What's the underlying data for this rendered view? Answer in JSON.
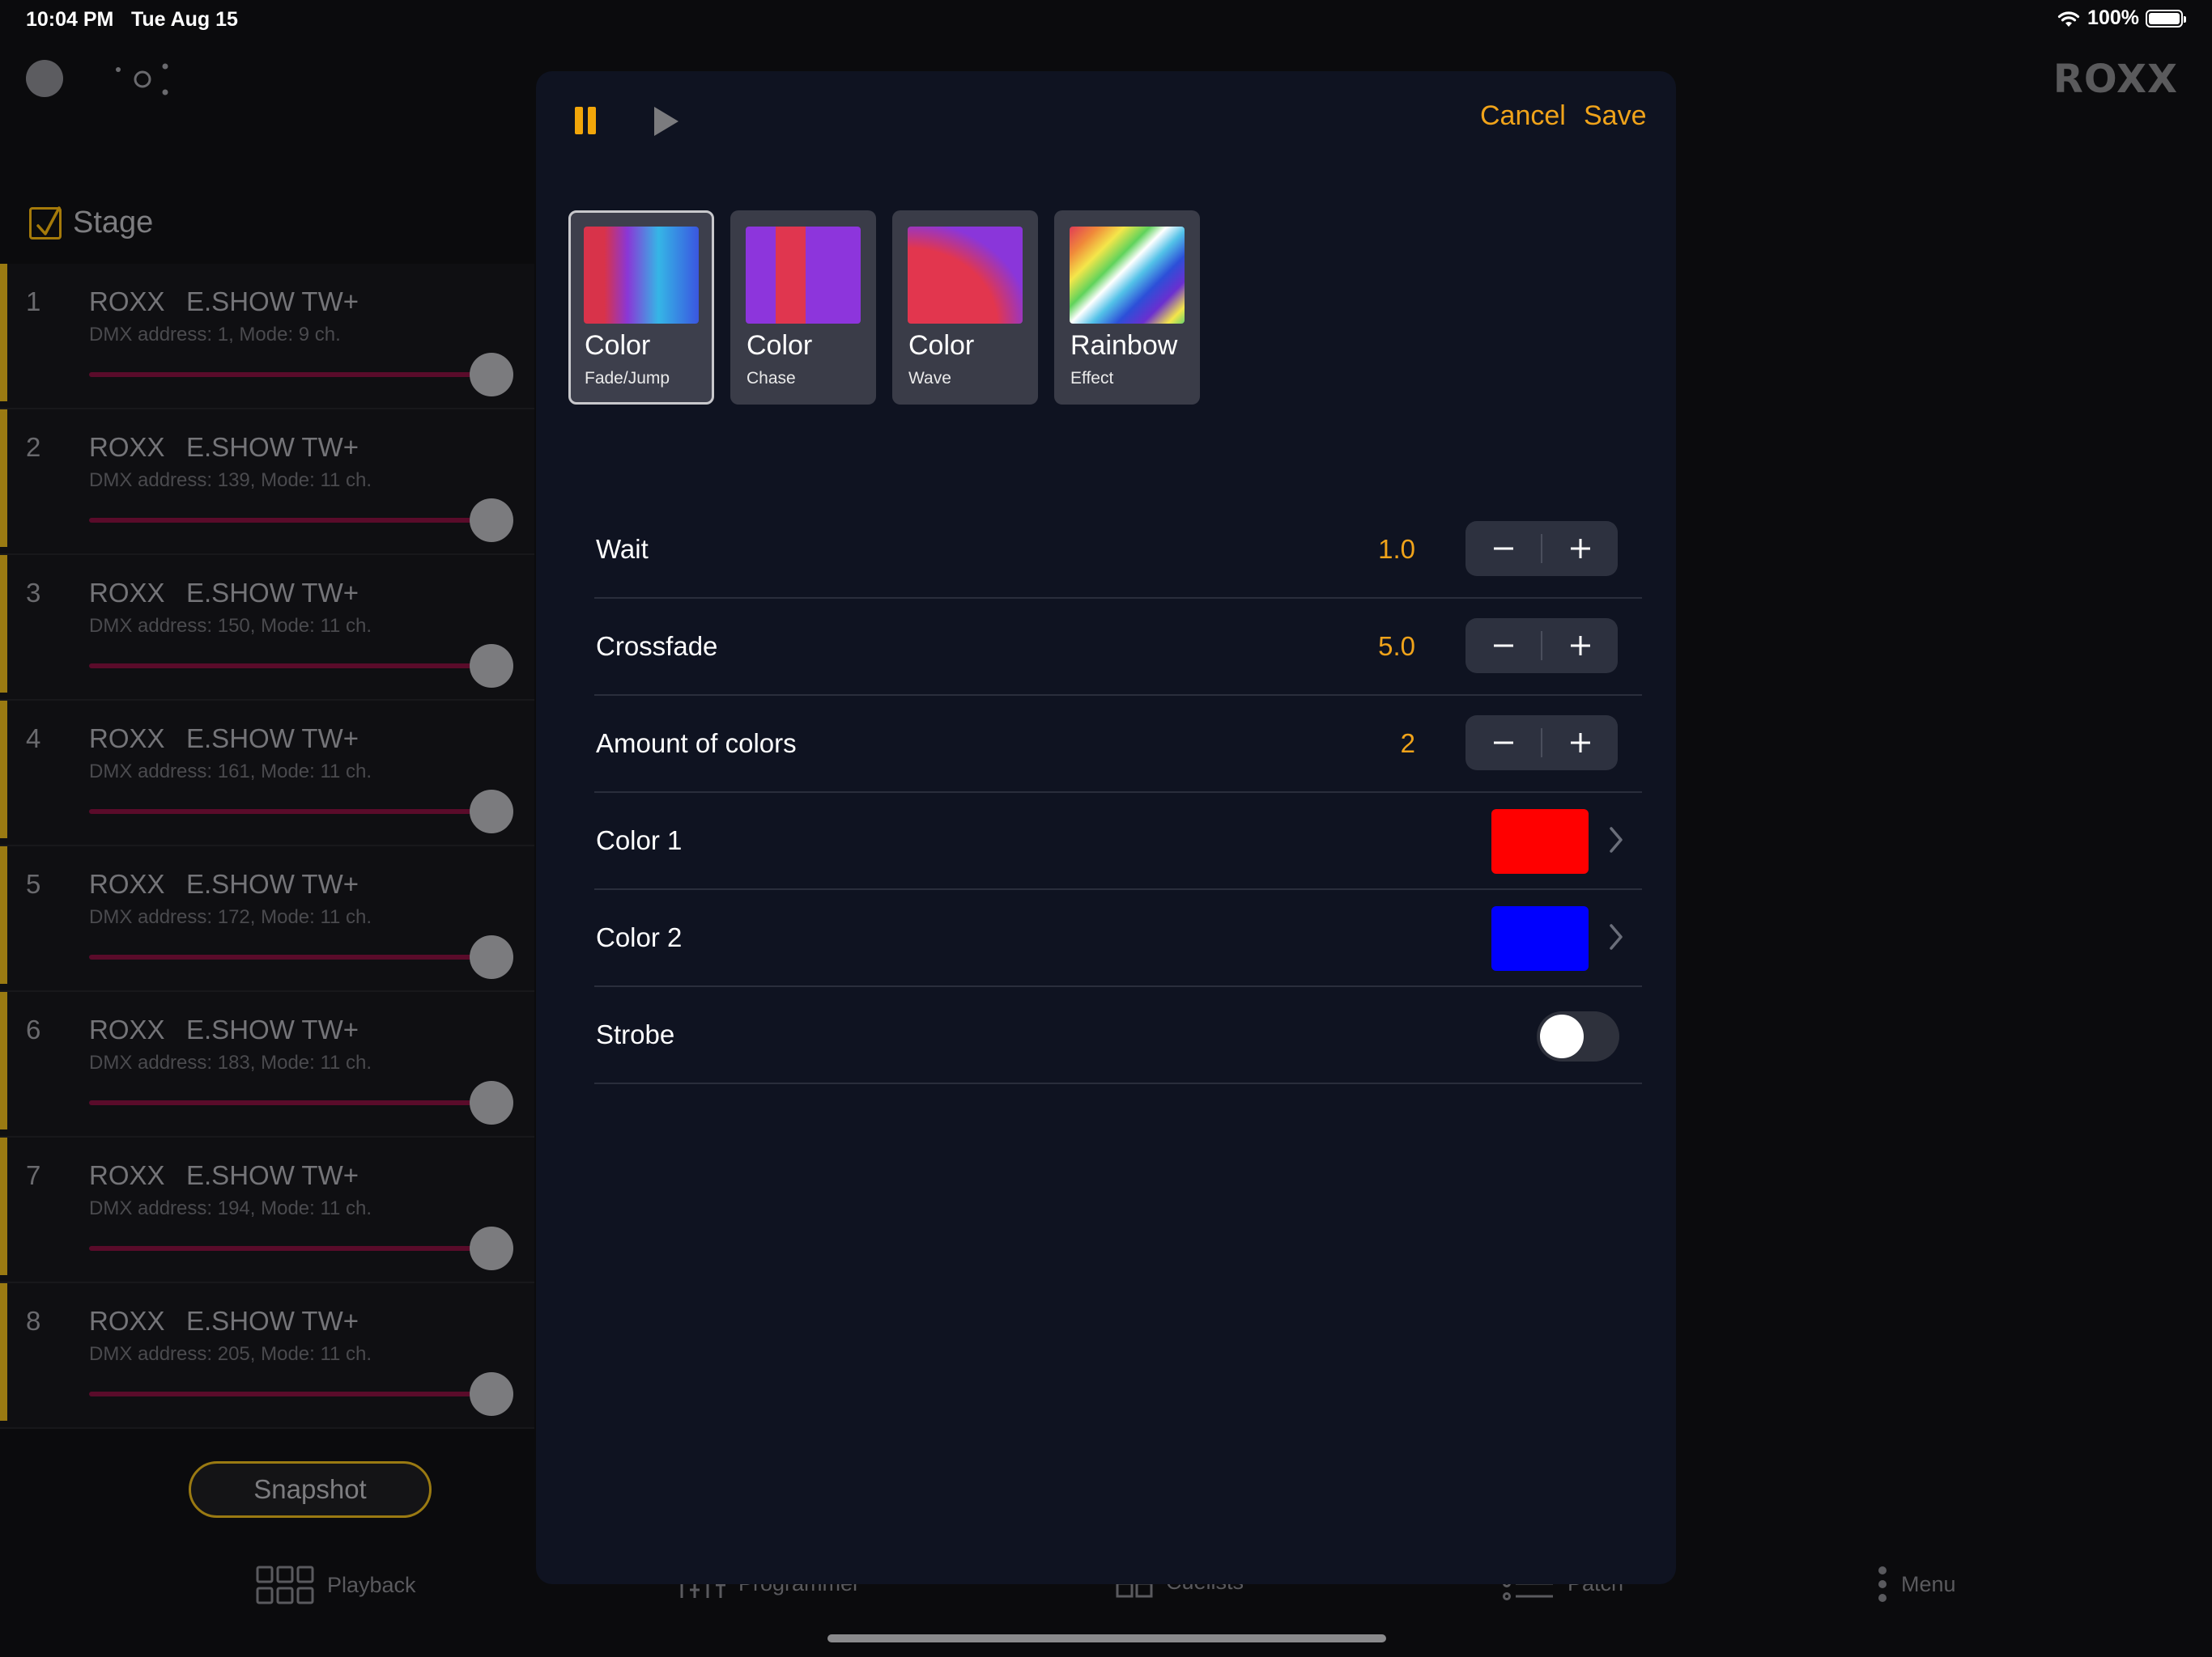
{
  "status_bar": {
    "time": "10:04 PM",
    "date": "Tue Aug 15",
    "battery": "100%",
    "icons": [
      "wifi-icon",
      "battery-icon"
    ]
  },
  "app": {
    "logo": "ROXX",
    "top_icons": [
      "status-circle-icon",
      "network-dots-icon"
    ]
  },
  "stage": {
    "label": "Stage",
    "checked": true
  },
  "fixtures": [
    {
      "num": "1",
      "brand": "ROXX",
      "model": "E.SHOW TW+",
      "info": "DMX address: 1, Mode: 9 ch."
    },
    {
      "num": "2",
      "brand": "ROXX",
      "model": "E.SHOW TW+",
      "info": "DMX address: 139, Mode: 11 ch."
    },
    {
      "num": "3",
      "brand": "ROXX",
      "model": "E.SHOW TW+",
      "info": "DMX address: 150, Mode: 11 ch."
    },
    {
      "num": "4",
      "brand": "ROXX",
      "model": "E.SHOW TW+",
      "info": "DMX address: 161, Mode: 11 ch."
    },
    {
      "num": "5",
      "brand": "ROXX",
      "model": "E.SHOW TW+",
      "info": "DMX address: 172, Mode: 11 ch."
    },
    {
      "num": "6",
      "brand": "ROXX",
      "model": "E.SHOW TW+",
      "info": "DMX address: 183, Mode: 11 ch."
    },
    {
      "num": "7",
      "brand": "ROXX",
      "model": "E.SHOW TW+",
      "info": "DMX address: 194, Mode: 11 ch."
    },
    {
      "num": "8",
      "brand": "ROXX",
      "model": "E.SHOW TW+",
      "info": "DMX address: 205, Mode: 11 ch."
    }
  ],
  "fixture_level": 1.0,
  "snapshot_label": "Snapshot",
  "tabs": [
    {
      "label": "Playback",
      "icon": "grid-icon"
    },
    {
      "label": "Programmer",
      "icon": "faders-icon"
    },
    {
      "label": "Cuelists",
      "icon": "cuelist-icon"
    },
    {
      "label": "Patch",
      "icon": "list-icon"
    },
    {
      "label": "Menu",
      "icon": "vertical-dots-icon"
    }
  ],
  "modal": {
    "cancel_label": "Cancel",
    "save_label": "Save",
    "transport_icons": [
      "pause-icon",
      "play-icon"
    ],
    "accent_color": "#f0a31a",
    "effects": [
      {
        "name": "Color",
        "sub": "Fade/Jump",
        "selected": true
      },
      {
        "name": "Color",
        "sub": "Chase",
        "selected": false
      },
      {
        "name": "Color",
        "sub": "Wave",
        "selected": false
      },
      {
        "name": "Rainbow",
        "sub": "Effect",
        "selected": false
      }
    ],
    "settings": {
      "wait": {
        "label": "Wait",
        "value": "1.0"
      },
      "crossfade": {
        "label": "Crossfade",
        "value": "5.0"
      },
      "amount": {
        "label": "Amount of colors",
        "value": "2"
      },
      "color1": {
        "label": "Color 1",
        "color": "#ff0000"
      },
      "color2": {
        "label": "Color 2",
        "color": "#0000ff"
      },
      "strobe": {
        "label": "Strobe",
        "on": false
      }
    }
  }
}
